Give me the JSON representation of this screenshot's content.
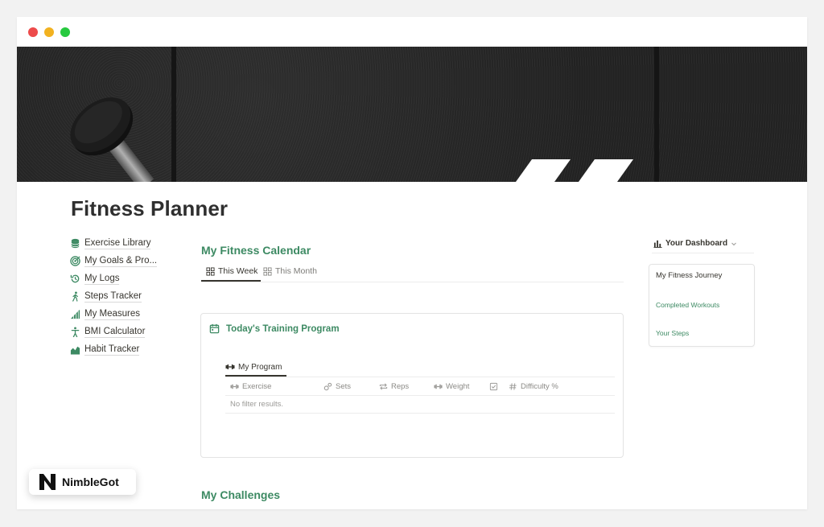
{
  "page": {
    "title": "Fitness Planner"
  },
  "sidebar": {
    "items": [
      {
        "label": "Exercise Library",
        "icon": "database-icon"
      },
      {
        "label": "My Goals & Pro...",
        "icon": "target-icon"
      },
      {
        "label": "My Logs",
        "icon": "history-icon"
      },
      {
        "label": "Steps Tracker",
        "icon": "walking-icon"
      },
      {
        "label": "My Measures",
        "icon": "bar-growth-icon"
      },
      {
        "label": "BMI Calculator",
        "icon": "person-icon"
      },
      {
        "label": "Habit Tracker",
        "icon": "area-chart-icon"
      }
    ]
  },
  "calendar": {
    "title": "My Fitness Calendar",
    "tabs": [
      {
        "label": "This Week",
        "active": true
      },
      {
        "label": "This Month",
        "active": false
      }
    ]
  },
  "training": {
    "title": "Today's Training Program",
    "program_tab": "My Program",
    "columns": [
      "Exercise",
      "Sets",
      "Reps",
      "Weight",
      "",
      "Difficulty %"
    ],
    "empty_text": "No filter results."
  },
  "challenges": {
    "title": "My Challenges"
  },
  "dashboard": {
    "title": "Your Dashboard",
    "card_title": "My Fitness Journey",
    "links": [
      "Completed Workouts",
      "Your Steps"
    ]
  },
  "brand": {
    "name": "NimbleGot"
  },
  "colors": {
    "accent": "#3d8a63",
    "text": "#37352f",
    "muted": "#8b8a86"
  }
}
